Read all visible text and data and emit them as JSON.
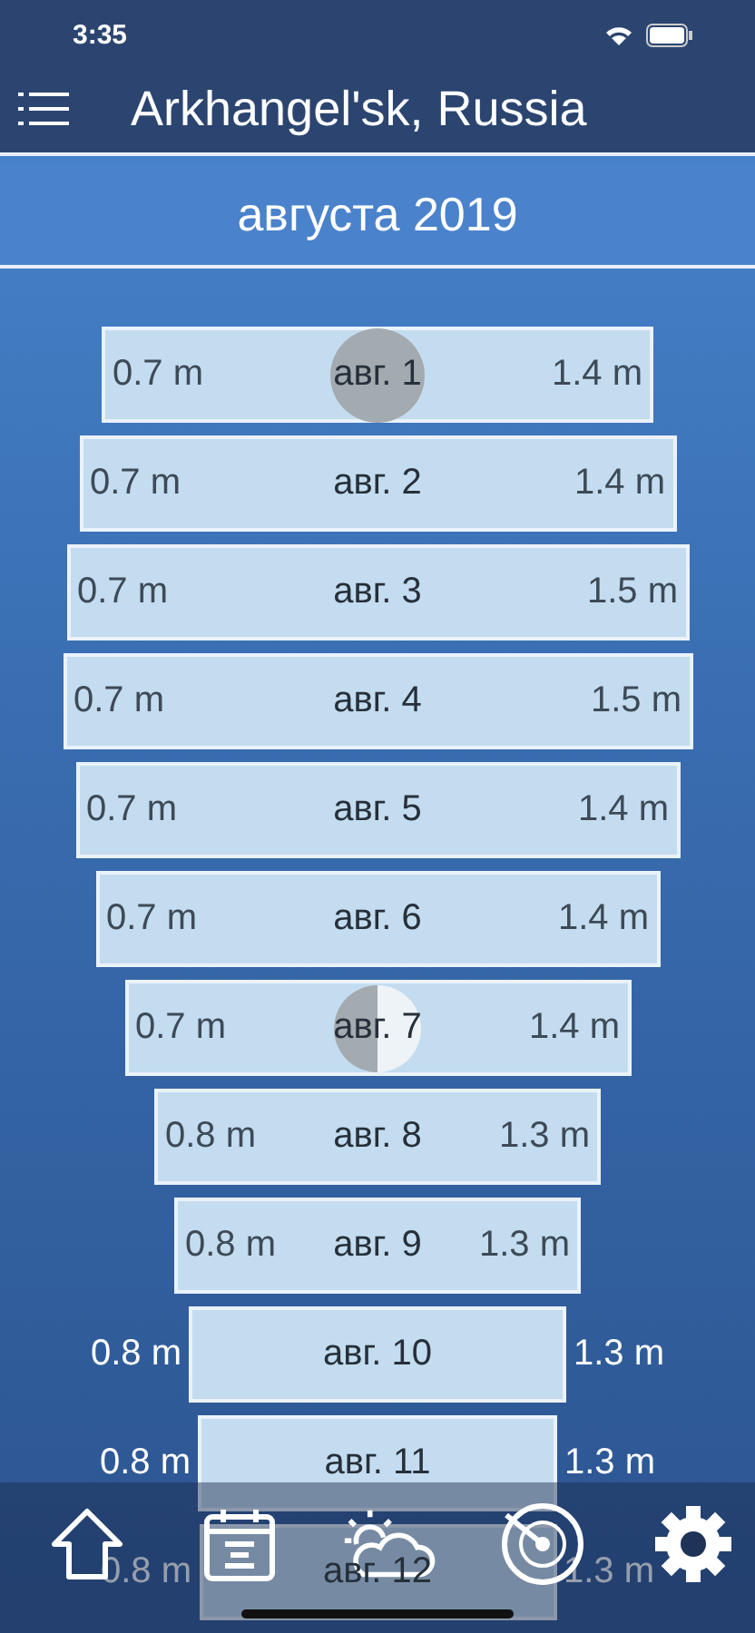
{
  "status_bar": {
    "time": "3:35"
  },
  "header": {
    "title": "Arkhangel'sk, Russia"
  },
  "month": "августа 2019",
  "rows": [
    {
      "kind": "new_moon",
      "low": "0.7 m",
      "date": "авг. 1",
      "high": "1.4 m"
    },
    {
      "kind": "plain",
      "low": "0.7 m",
      "date": "авг. 2",
      "high": "1.4 m"
    },
    {
      "kind": "plain",
      "low": "0.7 m",
      "date": "авг. 3",
      "high": "1.5 m"
    },
    {
      "kind": "plain",
      "low": "0.7 m",
      "date": "авг. 4",
      "high": "1.5 m"
    },
    {
      "kind": "plain",
      "low": "0.7 m",
      "date": "авг. 5",
      "high": "1.4 m"
    },
    {
      "kind": "plain",
      "low": "0.7 m",
      "date": "авг. 6",
      "high": "1.4 m"
    },
    {
      "kind": "first_quarter",
      "low": "0.7 m",
      "date": "авг. 7",
      "high": "1.4 m"
    },
    {
      "kind": "plain",
      "low": "0.8 m",
      "date": "авг. 8",
      "high": "1.3 m"
    },
    {
      "kind": "plain",
      "low": "0.8 m",
      "date": "авг. 9",
      "high": "1.3 m"
    },
    {
      "kind": "plain",
      "low": "0.8 m",
      "date": "авг. 10",
      "high": "1.3 m"
    },
    {
      "kind": "plain",
      "low": "0.8 m",
      "date": "авг. 11",
      "high": "1.3 m"
    },
    {
      "kind": "plain",
      "low": "0.8 m",
      "date": "авг. 12",
      "high": "1.3 m"
    }
  ],
  "tabs": [
    {
      "kind": "home"
    },
    {
      "kind": "calendar"
    },
    {
      "kind": "weather"
    },
    {
      "kind": "radar"
    },
    {
      "kind": "settings"
    }
  ]
}
